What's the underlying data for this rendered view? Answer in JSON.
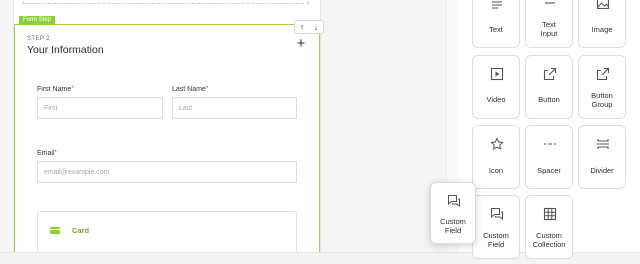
{
  "form": {
    "step_tag": "Form Step",
    "step_label": "STEP 2",
    "step_title": "Your Information",
    "add_button": "+",
    "move_up": "↑",
    "move_down": "↓",
    "first_name": {
      "label": "First Name",
      "required": "*",
      "placeholder": "First"
    },
    "last_name": {
      "label": "Last Name",
      "required": "*",
      "placeholder": "Last"
    },
    "email": {
      "label": "Email",
      "required": "*",
      "placeholder": "email@example.com"
    },
    "card": {
      "label": "Card"
    }
  },
  "palette": {
    "tiles": [
      {
        "label": "Text",
        "icon": "text-icon"
      },
      {
        "label": "Text Input",
        "icon": "text-input-icon"
      },
      {
        "label": "Image",
        "icon": "image-icon"
      },
      {
        "label": "Video",
        "icon": "video-icon"
      },
      {
        "label": "Button",
        "icon": "external-link-icon"
      },
      {
        "label": "Button Group",
        "icon": "external-link-group-icon"
      },
      {
        "label": "Icon",
        "icon": "star-icon"
      },
      {
        "label": "Spacer",
        "icon": "spacer-icon"
      },
      {
        "label": "Divider",
        "icon": "divider-icon"
      },
      {
        "label": "Custom Field",
        "icon": "chat-icon"
      },
      {
        "label": "Custom Collection",
        "icon": "table-icon"
      }
    ],
    "dragging": {
      "label": "Custom Field",
      "icon": "chat-icon"
    }
  },
  "colors": {
    "accent": "#8ccf3a",
    "accent_text": "#6db028",
    "required": "#c0392b",
    "border": "#dedede"
  }
}
